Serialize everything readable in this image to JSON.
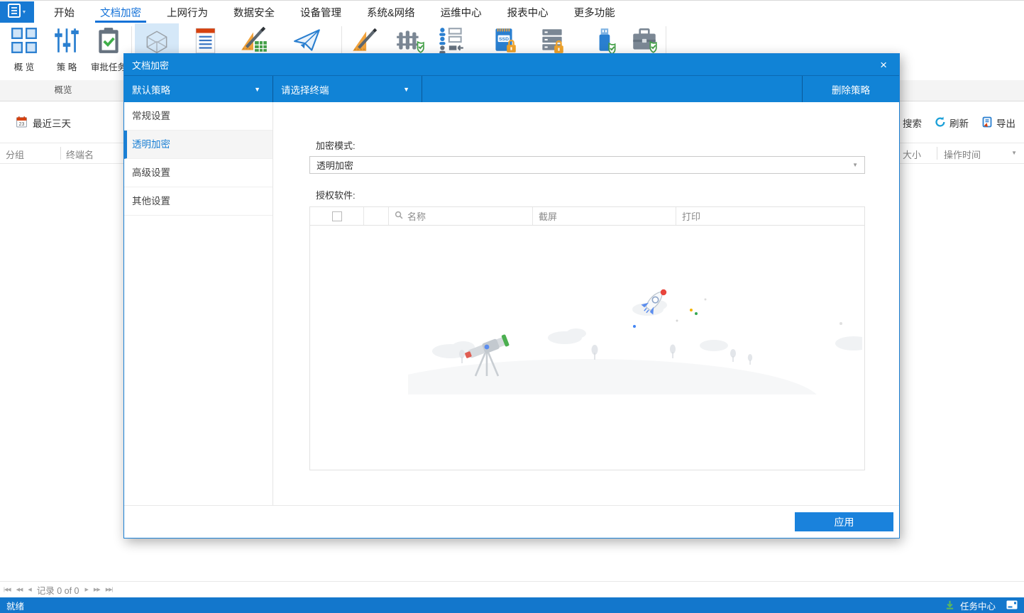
{
  "colors": {
    "primary": "#1183d6",
    "accent": "#1a7fd4",
    "statusbar": "#1377cc",
    "ribbon_selected_bg": "#d5e8f8",
    "active_tab": "#1472d8"
  },
  "icons": {
    "close": "×",
    "dropdown_arrow": "▼",
    "pager_first": "|◀◀",
    "pager_fast_prev": "◀◀",
    "pager_prev": "◀",
    "pager_next": "▶",
    "pager_fast_next": "▶▶",
    "pager_last": "▶▶|"
  },
  "menubar": {
    "tabs": [
      {
        "label": "开始"
      },
      {
        "label": "文档加密",
        "active": true
      },
      {
        "label": "上网行为"
      },
      {
        "label": "数据安全"
      },
      {
        "label": "设备管理"
      },
      {
        "label": "系统&网络"
      },
      {
        "label": "运维中心"
      },
      {
        "label": "报表中心"
      },
      {
        "label": "更多功能"
      }
    ]
  },
  "ribbon": {
    "group_label": "概览",
    "buttons": [
      {
        "label": "概 览"
      },
      {
        "label": "策 略"
      },
      {
        "label": "审批任务"
      }
    ]
  },
  "workspace": {
    "date_filter": "最近三天",
    "search": "搜索",
    "refresh": "刷新",
    "export": "导出",
    "col_group": "分组",
    "col_terminal": "终端名",
    "col_size": "大小",
    "col_time": "操作时间"
  },
  "dialog": {
    "title": "文档加密",
    "policy_select": "默认策略",
    "terminal_select": "请选择终端",
    "delete_button": "删除策略",
    "nav": [
      {
        "label": "常规设置"
      },
      {
        "label": "透明加密",
        "active": true
      },
      {
        "label": "高级设置"
      },
      {
        "label": "其他设置"
      }
    ],
    "mode_label": "加密模式:",
    "mode_value": "透明加密",
    "software_label": "授权软件:",
    "col_name": "名称",
    "col_screenshot": "截屏",
    "col_print": "打印",
    "apply_button": "应用"
  },
  "pagination": {
    "record_text": "记录 0 of 0"
  },
  "statusbar": {
    "ready": "就绪",
    "task_center": "任务中心"
  }
}
